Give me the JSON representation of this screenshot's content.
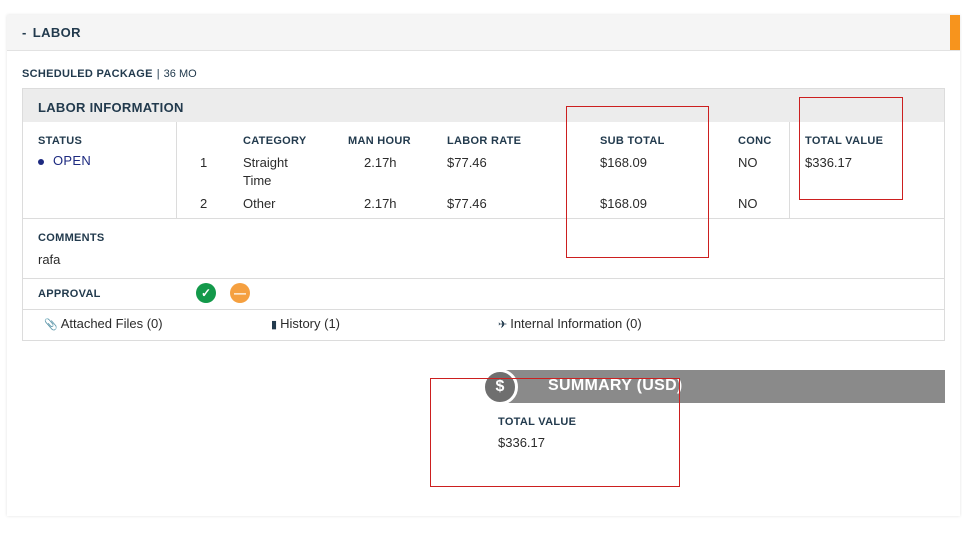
{
  "section": {
    "toggle": "-",
    "title": "LABOR"
  },
  "package": {
    "label": "SCHEDULED PACKAGE",
    "separator": "|",
    "value": "36 MO"
  },
  "labor_info": {
    "title": "LABOR INFORMATION",
    "status_label": "STATUS",
    "status_value": "OPEN",
    "columns": {
      "category": "CATEGORY",
      "man_hour": "MAN HOUR",
      "labor_rate": "LABOR RATE",
      "sub_total": "SUB TOTAL",
      "conc": "CONC",
      "total_value": "TOTAL VALUE"
    },
    "rows": [
      {
        "num": "1",
        "category_line1": "Straight",
        "category_line2": "Time",
        "man_hour": "2.17h",
        "labor_rate": "$77.46",
        "sub_total": "$168.09",
        "conc": "NO"
      },
      {
        "num": "2",
        "category": "Other",
        "man_hour": "2.17h",
        "labor_rate": "$77.46",
        "sub_total": "$168.09",
        "conc": "NO"
      }
    ],
    "total_value": "$336.17",
    "comments_label": "COMMENTS",
    "comments_value": "rafa",
    "approval_label": "APPROVAL",
    "approval_icons": [
      "check-circle-icon",
      "minus-circle-icon"
    ],
    "links": {
      "attached": "Attached Files (0)",
      "history": "History (1)",
      "internal": "Internal Information (0)"
    }
  },
  "summary": {
    "icon": "$",
    "title": "SUMMARY (USD)",
    "total_label": "TOTAL VALUE",
    "total_value": "$336.17"
  },
  "colors": {
    "accent": "#f7941d",
    "status": "#1d2a80",
    "approve": "#13994a",
    "pending": "#f5a040",
    "summary_bar": "#8a8a8a",
    "highlight": "#cc1f1f"
  }
}
